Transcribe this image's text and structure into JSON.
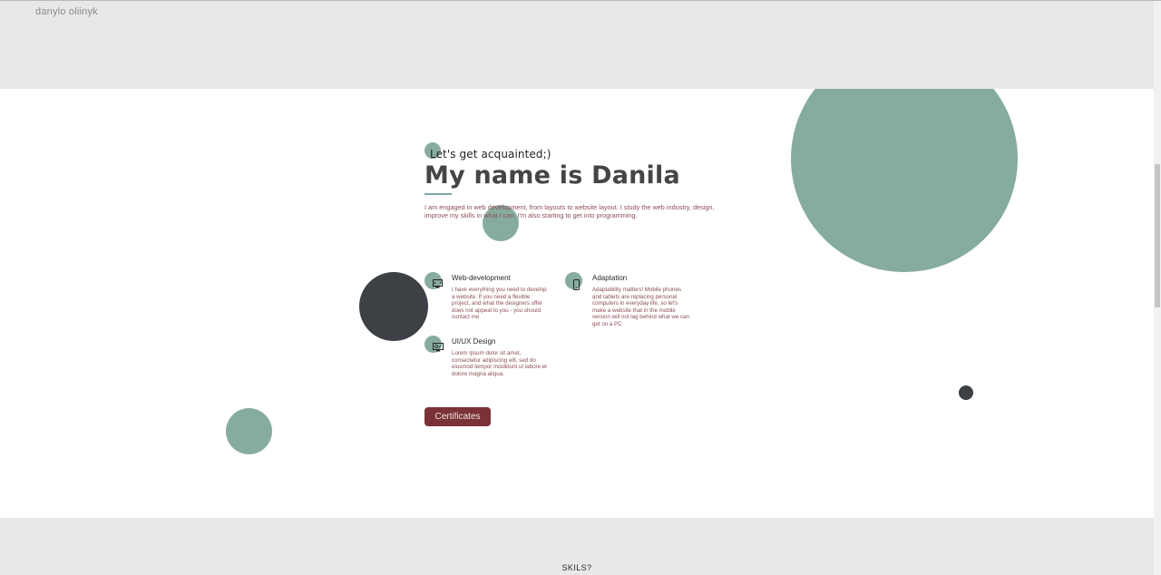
{
  "header": {
    "logo_text": "danylo oliinyk"
  },
  "intro": {
    "greeting": "Let's get acquainted;)",
    "title": "My name is Danila",
    "description": "I am engaged in web development, from layouts to website layout. I study the web industry, design, improve my skills in what I can. I'm also starting to get into programming."
  },
  "services": [
    {
      "title": "Web-development",
      "icon": "monitor-code-icon",
      "text": "I have everything you need to develop a website. If you need a flexible project, and what the designers offer does not appeal to you - you should contact me"
    },
    {
      "title": "Adaptation",
      "icon": "mobile-phone-icon",
      "text": "Adaptability matters! Mobile phones and tablets are replacing personal computers in everyday life, so let's make a website that in the mobile version will not lag behind what we can get on a PC"
    },
    {
      "title": "UI/UX Design",
      "icon": "design-monitor-icon",
      "text": "Lorem ipsum dolor sit amet, consectetur adipiscing elit, sed do eiusmod tempor incididunt ut labore et dolore magna aliqua."
    }
  ],
  "cta": {
    "label": "Certificates"
  },
  "footer": {
    "section_title": "SKILS?"
  },
  "colors": {
    "accent_green": "#86ac9f",
    "dark_circle": "#3d4044",
    "button_bg": "#7a3236",
    "text_accent": "#8e4f55",
    "section_bg": "#e8e8e8"
  }
}
